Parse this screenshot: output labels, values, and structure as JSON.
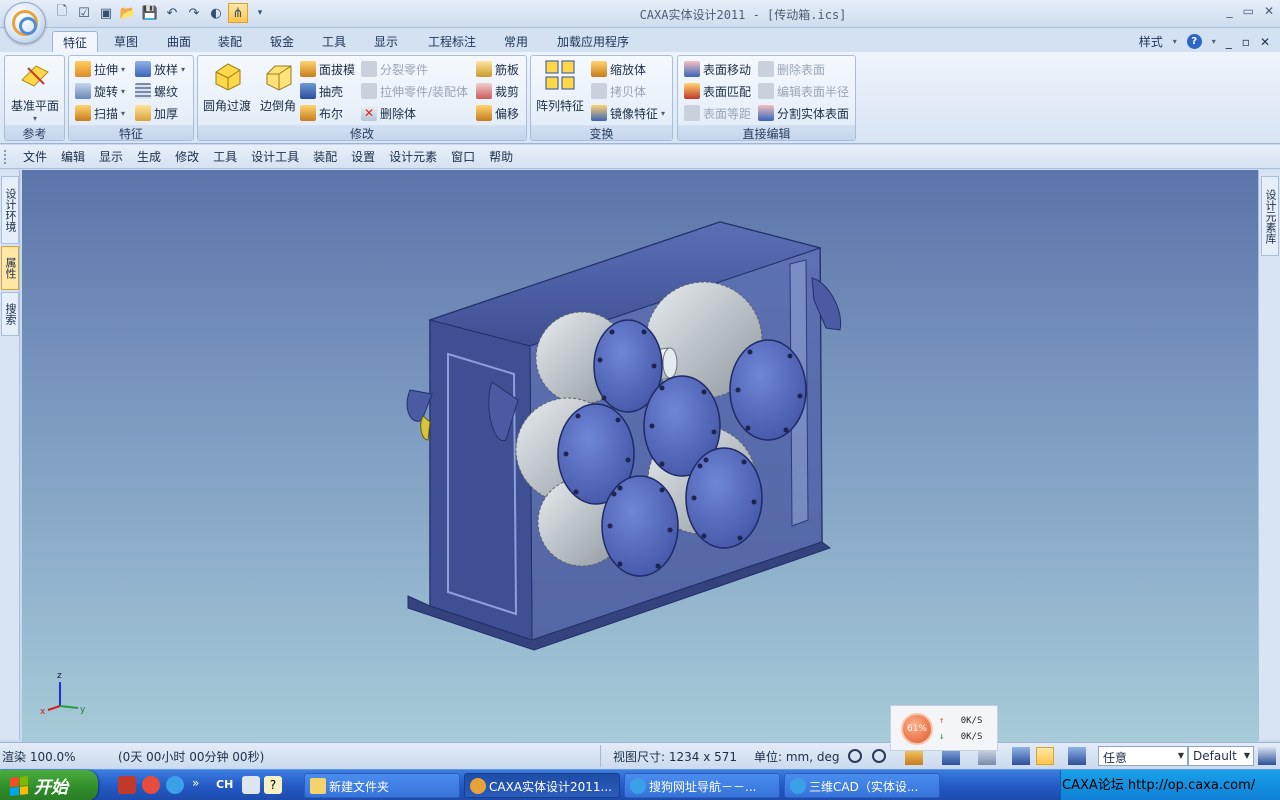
{
  "window": {
    "title": "CAXA实体设计2011 - [传动箱.ics]",
    "controls": [
      "_",
      "▭",
      "✕"
    ]
  },
  "ribbon": {
    "tabs": [
      "特征",
      "草图",
      "曲面",
      "装配",
      "钣金",
      "工具",
      "显示",
      "工程标注",
      "常用",
      "加载应用程序"
    ],
    "active_tab": "特征",
    "style_label": "样式",
    "groups": {
      "reference": {
        "label": "参考",
        "datum_plane": "基准平面"
      },
      "feature": {
        "label": "特征",
        "extrude": "拉伸",
        "loft": "放样",
        "revolve": "旋转",
        "thread": "螺纹",
        "sweep": "扫描",
        "thicken": "加厚"
      },
      "modify": {
        "label": "修改",
        "fillet": "圆角过渡",
        "chamfer": "边倒角",
        "draft": "面拔模",
        "shell": "抽壳",
        "boolean": "布尔",
        "split_part": "分裂零件",
        "stretch_part": "拉伸零件/装配体",
        "delete_body": "删除体",
        "rib": "筋板",
        "trim": "裁剪",
        "offset": "偏移"
      },
      "transform": {
        "label": "变换",
        "pattern": "阵列特征",
        "scale": "缩放体",
        "copy": "拷贝体",
        "mirror": "镜像特征"
      },
      "direct_edit": {
        "label": "直接编辑",
        "move_face": "表面移动",
        "delete_face": "删除表面",
        "match_face": "表面匹配",
        "edit_radius": "编辑表面半径",
        "offset_face": "表面等距",
        "split_solid": "分割实体表面"
      }
    }
  },
  "menubar": [
    "文件",
    "编辑",
    "显示",
    "生成",
    "修改",
    "工具",
    "设计工具",
    "装配",
    "设置",
    "设计元素",
    "窗口",
    "帮助"
  ],
  "left_panel_tabs": [
    "设计环境",
    "属性",
    "搜索"
  ],
  "right_panel_tabs": [
    "设计元素库"
  ],
  "axis": {
    "x": "x",
    "y": "y",
    "z": "z"
  },
  "network": {
    "percent": "61%",
    "up": "0K/S",
    "down": "0K/S"
  },
  "status": {
    "render": "渲染 100.0%",
    "time": "(0天 00小时 00分钟 00秒)",
    "view_size": "视图尺寸: 1234 x  571",
    "units": "单位: mm, deg",
    "filter": "任意",
    "scheme": "Default"
  },
  "taskbar": {
    "start": "开始",
    "lang": "CH",
    "tasks": [
      "新建文件夹",
      "CAXA实体设计2011...",
      "搜狗网址导航－－...",
      "三维CAD（实体设..."
    ],
    "tray_text": "CAXA论坛 http://op.caxa.com/"
  },
  "colors": {
    "accent": "#ffc64a",
    "viewport_top": "#5c74aa",
    "viewport_bottom": "#a7cbd8",
    "part_blue": "#4a5fa8"
  }
}
